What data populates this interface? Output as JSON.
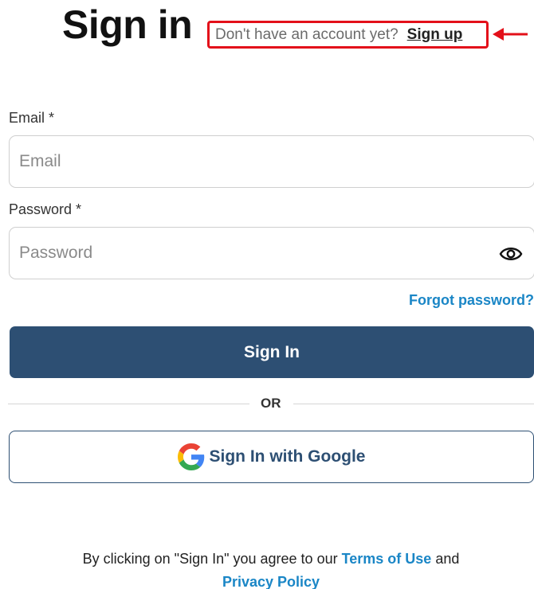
{
  "header": {
    "title": "Sign in",
    "signup_prompt": "Don't have an account yet?",
    "signup_link": "Sign up"
  },
  "form": {
    "email_label": "Email *",
    "email_placeholder": "Email",
    "email_value": "",
    "password_label": "Password *",
    "password_placeholder": "Password",
    "password_value": "",
    "forgot_password": "Forgot password?",
    "sign_in_button": "Sign In",
    "divider_text": "OR",
    "google_button": "Sign In with Google"
  },
  "footer": {
    "agreement_text": "By clicking on \"Sign In\" you agree to our",
    "terms_link": "Terms of Use",
    "conjunction": "and",
    "privacy_link": "Privacy Policy"
  },
  "colors": {
    "primary": "#2d4f73",
    "link": "#1a86c6",
    "highlight": "#e3101a"
  },
  "icons": {
    "password_toggle": "eye-icon",
    "google": "google-logo-icon",
    "annotation": "arrow-left-icon"
  }
}
